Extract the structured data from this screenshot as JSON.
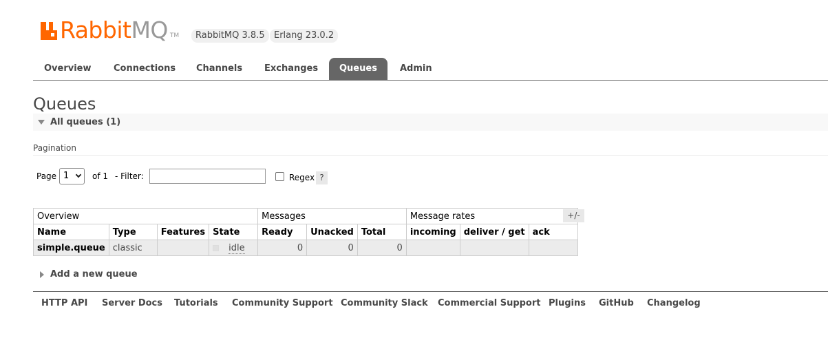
{
  "app": {
    "brand_rabbit": "Rabbit",
    "brand_mq": "MQ",
    "brand_tm": "TM",
    "version_badge": "RabbitMQ 3.8.5",
    "erlang_badge": "Erlang 23.0.2",
    "brand_color": "#ff6600"
  },
  "tabs": [
    {
      "label": "Overview",
      "active": false
    },
    {
      "label": "Connections",
      "active": false
    },
    {
      "label": "Channels",
      "active": false
    },
    {
      "label": "Exchanges",
      "active": false
    },
    {
      "label": "Queues",
      "active": true
    },
    {
      "label": "Admin",
      "active": false
    }
  ],
  "page": {
    "title": "Queues",
    "section_label": "All queues (1)",
    "pagination_title": "Pagination"
  },
  "pagination": {
    "page_label": "Page",
    "page_value": "1",
    "of_label": "of 1",
    "filter_label": "- Filter:",
    "filter_value": "",
    "regex_label": "Regex",
    "regex_checked": false,
    "help": "?"
  },
  "table": {
    "groups": [
      "Overview",
      "Messages",
      "Message rates"
    ],
    "columns": [
      "Name",
      "Type",
      "Features",
      "State",
      "Ready",
      "Unacked",
      "Total",
      "incoming",
      "deliver / get",
      "ack"
    ],
    "rows": [
      {
        "name": "simple.queue",
        "type": "classic",
        "features": "",
        "state": "idle",
        "ready": "0",
        "unacked": "0",
        "total": "0",
        "incoming": "",
        "deliver_get": "",
        "ack": ""
      }
    ],
    "toggle_columns": "+/-"
  },
  "add_queue": "Add a new queue",
  "footer": [
    "HTTP API",
    "Server Docs",
    "Tutorials",
    "Community Support",
    "Community Slack",
    "Commercial Support",
    "Plugins",
    "GitHub",
    "Changelog"
  ]
}
